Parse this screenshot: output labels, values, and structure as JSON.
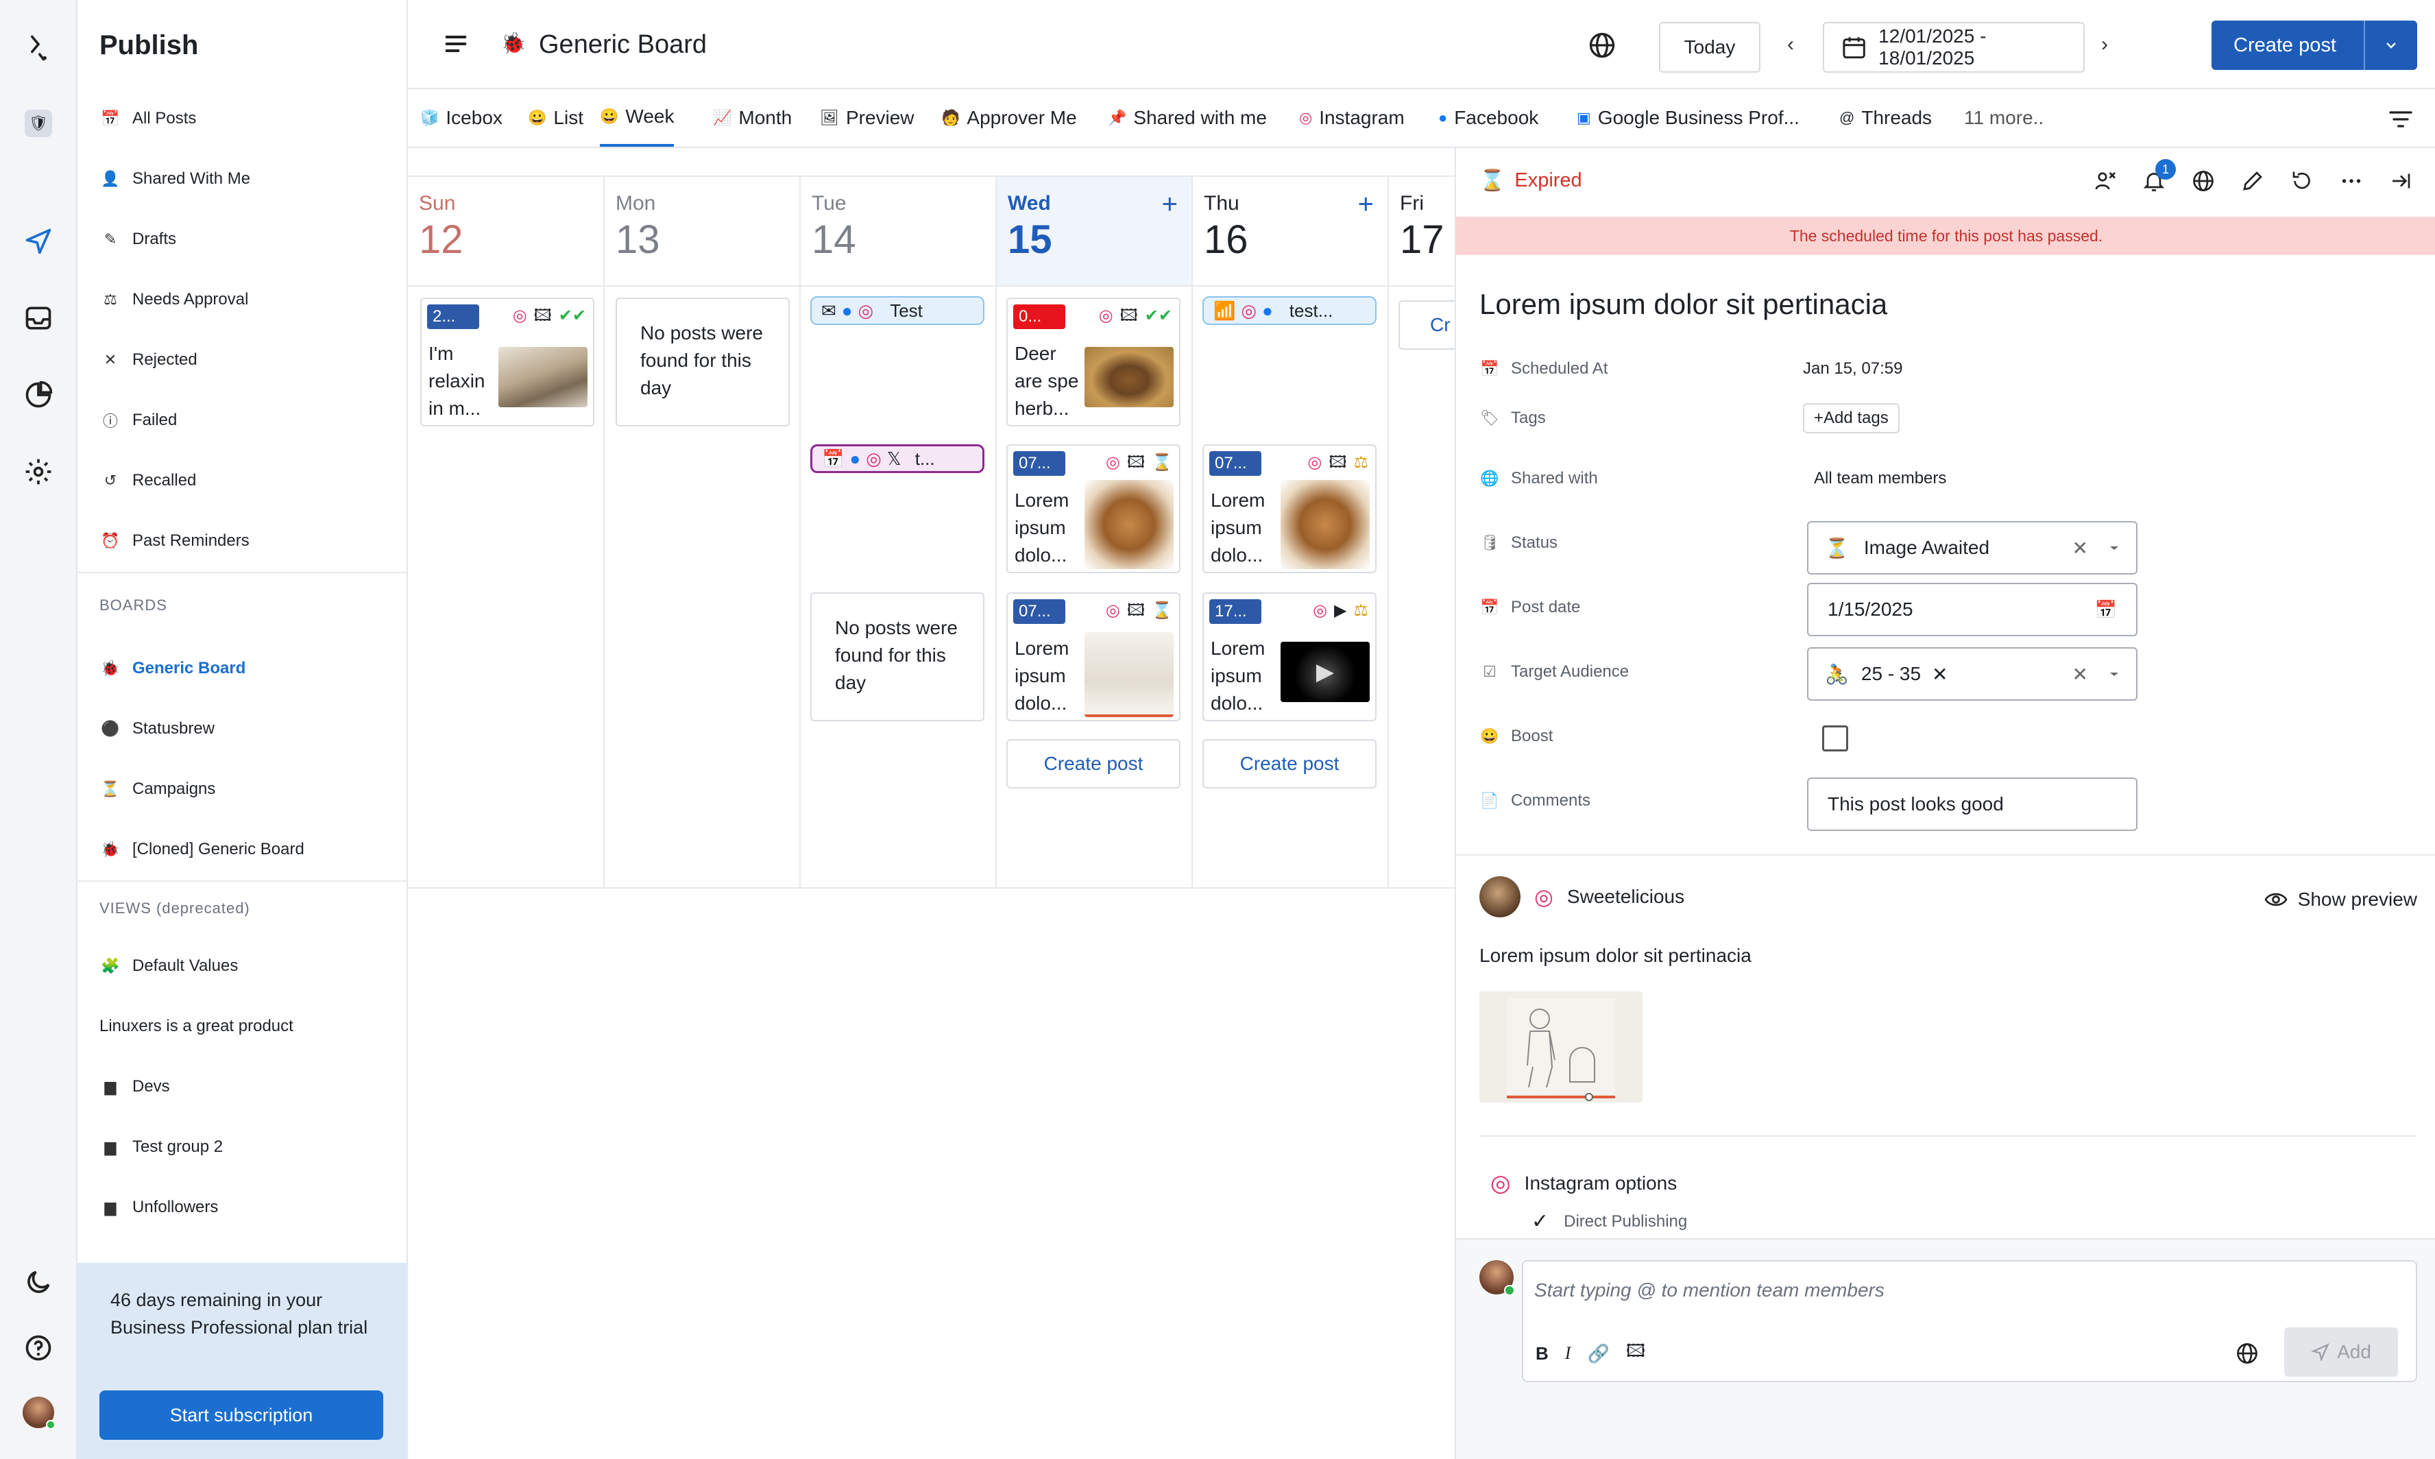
{
  "sidebar": {
    "title": "Publish",
    "items": [
      {
        "label": "All Posts",
        "icon": "calendar-icon"
      },
      {
        "label": "Shared With Me",
        "icon": "person-icon"
      },
      {
        "label": "Drafts",
        "icon": "draft-icon"
      },
      {
        "label": "Needs Approval",
        "icon": "approval-icon"
      },
      {
        "label": "Rejected",
        "icon": "x-icon"
      },
      {
        "label": "Failed",
        "icon": "alert-icon"
      },
      {
        "label": "Recalled",
        "icon": "undo-icon"
      },
      {
        "label": "Past Reminders",
        "icon": "alarm-icon"
      }
    ],
    "boards_heading": "BOARDS",
    "boards": [
      {
        "label": "Generic Board",
        "active": true
      },
      {
        "label": "Statusbrew"
      },
      {
        "label": "Campaigns"
      },
      {
        "label": "[Cloned] Generic Board"
      }
    ],
    "views_heading": "VIEWS (deprecated)",
    "views": [
      {
        "label": "Default Values"
      },
      {
        "label": "Linuxers is a great product"
      },
      {
        "label": "Devs"
      },
      {
        "label": "Test group 2"
      },
      {
        "label": "Unfollowers"
      }
    ],
    "trial_text": "46 days remaining in your Business Professional plan trial",
    "trial_button": "Start subscription"
  },
  "header": {
    "board_title": "Generic Board",
    "today": "Today",
    "date_range": "12/01/2025 - 18/01/2025",
    "create_post": "Create post"
  },
  "tabs": [
    {
      "label": "Icebox"
    },
    {
      "label": "List"
    },
    {
      "label": "Week",
      "active": true
    },
    {
      "label": "Month"
    },
    {
      "label": "Preview"
    },
    {
      "label": "Approver Me"
    },
    {
      "label": "Shared with me"
    },
    {
      "label": "Instagram"
    },
    {
      "label": "Facebook"
    },
    {
      "label": "Google Business Prof..."
    },
    {
      "label": "Threads"
    },
    {
      "label": "11 more.."
    }
  ],
  "calendar": {
    "days": [
      {
        "name": "Sun",
        "num": "12"
      },
      {
        "name": "Mon",
        "num": "13"
      },
      {
        "name": "Tue",
        "num": "14"
      },
      {
        "name": "Wed",
        "num": "15"
      },
      {
        "name": "Thu",
        "num": "16"
      },
      {
        "name": "Fri",
        "num": "17"
      }
    ],
    "empty_text": "No posts were found for this day",
    "create_post": "Create post",
    "cards": {
      "sun1": {
        "badge": "2...",
        "text": "I'm relaxin in m..."
      },
      "wed1": {
        "badge": "0...",
        "text": "Deer are spe herb..."
      },
      "wed2": {
        "badge": "07...",
        "text": "Lorem ipsum dolo..."
      },
      "wed3": {
        "badge": "07...",
        "text": "Lorem ipsum dolo..."
      },
      "thu1": {
        "badge": "07...",
        "text": "Lorem ipsum dolo..."
      },
      "thu2": {
        "badge": "17...",
        "text": "Lorem ipsum dolo..."
      }
    },
    "pills": {
      "tue1": "Test",
      "tue2": "t...",
      "thu1": "test...",
      "fri1": "Cr"
    }
  },
  "panel": {
    "status": "Expired",
    "notif_count": "1",
    "warning": "The scheduled time for this post has passed.",
    "title": "Lorem ipsum dolor sit pertinacia",
    "fields": {
      "scheduled_label": "Scheduled At",
      "scheduled_value": "Jan 15, 07:59",
      "tags_label": "Tags",
      "tags_button": "Add tags",
      "shared_label": "Shared with",
      "shared_value": "All team members",
      "status_label": "Status",
      "status_value": "Image Awaited",
      "postdate_label": "Post date",
      "postdate_value": "1/15/2025",
      "audience_label": "Target Audience",
      "audience_value": "25 - 35",
      "boost_label": "Boost",
      "comments_label": "Comments",
      "comments_value": "This post looks good"
    },
    "account": "Sweetelicious",
    "show_preview": "Show preview",
    "body": "Lorem ipsum dolor sit pertinacia",
    "ig_options": "Instagram options",
    "direct_publishing": "Direct Publishing",
    "comment_placeholder": "Start typing @ to mention team members",
    "add_button": "Add"
  },
  "colors": {
    "brand": "#1f5cb8",
    "accent": "#1a6fd1",
    "danger": "#d93025",
    "warn_bg": "#fcd3d3"
  }
}
